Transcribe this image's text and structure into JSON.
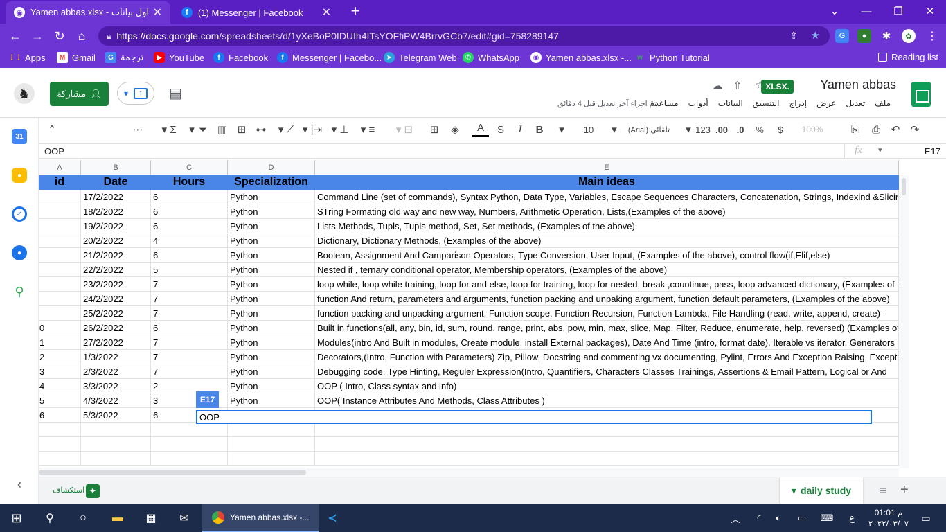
{
  "browser": {
    "tabs": [
      {
        "title": "Yamen abbas.xlsx - جداول بيانات Go",
        "active": true
      },
      {
        "title": "(1) Messenger | Facebook",
        "active": false
      }
    ],
    "url_host": "https://docs.google.com",
    "url_path": "/spreadsheets/d/1yXeBoP0IDUIh4ITsYOFfiPW4BrrvGCb7/edit#gid=758289147",
    "bookmarks": [
      "Apps",
      "Gmail",
      "ترجمة",
      "YouTube",
      "Facebook",
      "Messenger | Facebo...",
      "Telegram Web",
      "WhatsApp",
      "Yamen abbas.xlsx -...",
      "Python Tutorial"
    ],
    "reading_list": "Reading list"
  },
  "doc": {
    "title": "Yamen abbas",
    "badge": "XLSX.",
    "share_label": "مشاركة",
    "menus": [
      "ملف",
      "تعديل",
      "عرض",
      "إدراج",
      "التنسيق",
      "البيانات",
      "أدوات",
      "مساعدة"
    ],
    "last_edit": "تم اجراء آخر تعديل قبل 4 دقائق"
  },
  "toolbar": {
    "zoom": "100%",
    "currency": "$",
    "percent": "%",
    "dec1": ".0",
    "dec2": ".00",
    "numfmt": "123",
    "font": "(Arial) تلقائي",
    "font_size": "10"
  },
  "formula_bar": {
    "cell_ref": "E17",
    "content": "OOP"
  },
  "grid": {
    "columns": [
      "A",
      "B",
      "C",
      "D",
      "E"
    ],
    "header": [
      "id",
      "Date",
      "Hours",
      "Specialization",
      "Main ideas"
    ],
    "rows": [
      [
        "",
        "17/2/2022",
        "6",
        "Python",
        "Command Line (set of commands), Syntax Python, Data Type, Variables, Escape Sequences Characters, Concatenation, Strings, Indexind &Slicing"
      ],
      [
        "",
        "18/2/2022",
        "6",
        "Python",
        "STring Formating old way and new way, Numbers, Arithmetic Operation, Lists,(Examples of the above)"
      ],
      [
        "",
        "19/2/2022",
        "6",
        "Python",
        "Lists Methods, Tupls, Tupls method, Set, Set methods, (Examples of the above)"
      ],
      [
        "",
        "20/2/2022",
        "4",
        "Python",
        "Dictionary, Dictionary Methods,  (Examples of the above)"
      ],
      [
        "",
        "21/2/2022",
        "6",
        "Python",
        "Boolean, Assignment And Camparison Operators, Type Conversion, User Input, (Examples of the above), control flow(if,Elif,else)"
      ],
      [
        "",
        "22/2/2022",
        "5",
        "Python",
        "Nested if , ternary conditional operator, Membership operators, (Examples of the above)"
      ],
      [
        "",
        "23/2/2022",
        "7",
        "Python",
        "loop while, loop while training, loop for and else, loop for training, loop for nested, break ,countinue, pass, loop advanced dictionary, (Examples of the above)"
      ],
      [
        "",
        "24/2/2022",
        "7",
        "Python",
        "function And return, parameters and arguments, function packing and unpaking argument, function default parameters, (Examples of the above)"
      ],
      [
        "",
        "25/2/2022",
        "7",
        "Python",
        "function packing and unpacking argument, Function scope, Function Recursion, Function Lambda, File Handling (read, write, append, create)--"
      ],
      [
        "0",
        "26/2/2022",
        "6",
        "Python",
        "Built in functions(all, any, bin, id, sum, round, range, print, abs, pow, min, max, slice, Map, Filter, Reduce, enumerate, help, reversed) (Examples of the above)"
      ],
      [
        "1",
        "27/2/2022",
        "7",
        "Python",
        "Modules(intro And Built in modules, Create  module, install External packages), Date And Time (intro, format date), Iterable vs iterator, Generators"
      ],
      [
        "2",
        "1/3/2022",
        "7",
        "Python",
        "Decorators,(Intro, Function with Parameters) Zip, Pillow, Docstring and commenting vx documenting, Pylint, Errors And Exception Raising, Exception Handling"
      ],
      [
        "3",
        "2/3/2022",
        "7",
        "Python",
        "Debugging code, Type Hinting, Reguler Expression(Intro, Quantifiers, Characters Classes Trainings, Assertions & Email Pattern, Logical or And"
      ],
      [
        "4",
        "3/3/2022",
        "2",
        "Python",
        "OOP ( Intro, Class syntax and info)"
      ],
      [
        "5",
        "4/3/2022",
        "3",
        "Python",
        "OOP( Instance Attributes And Methods, Class Attributes )"
      ],
      [
        "6",
        "5/3/2022",
        "6",
        "",
        ""
      ],
      [
        "",
        "",
        "",
        "",
        ""
      ],
      [
        "",
        "",
        "",
        "",
        ""
      ],
      [
        "",
        "",
        "",
        "",
        ""
      ]
    ],
    "edit_value": "OOP",
    "edit_ref": "E17"
  },
  "sheets": {
    "active": "daily study",
    "explore": "استكشاف"
  },
  "taskbar": {
    "app": "Yamen abbas.xlsx -...",
    "time": "01:01 م",
    "date": "٢٠٢٢/٠٣/٠٧",
    "lang": "ع"
  }
}
